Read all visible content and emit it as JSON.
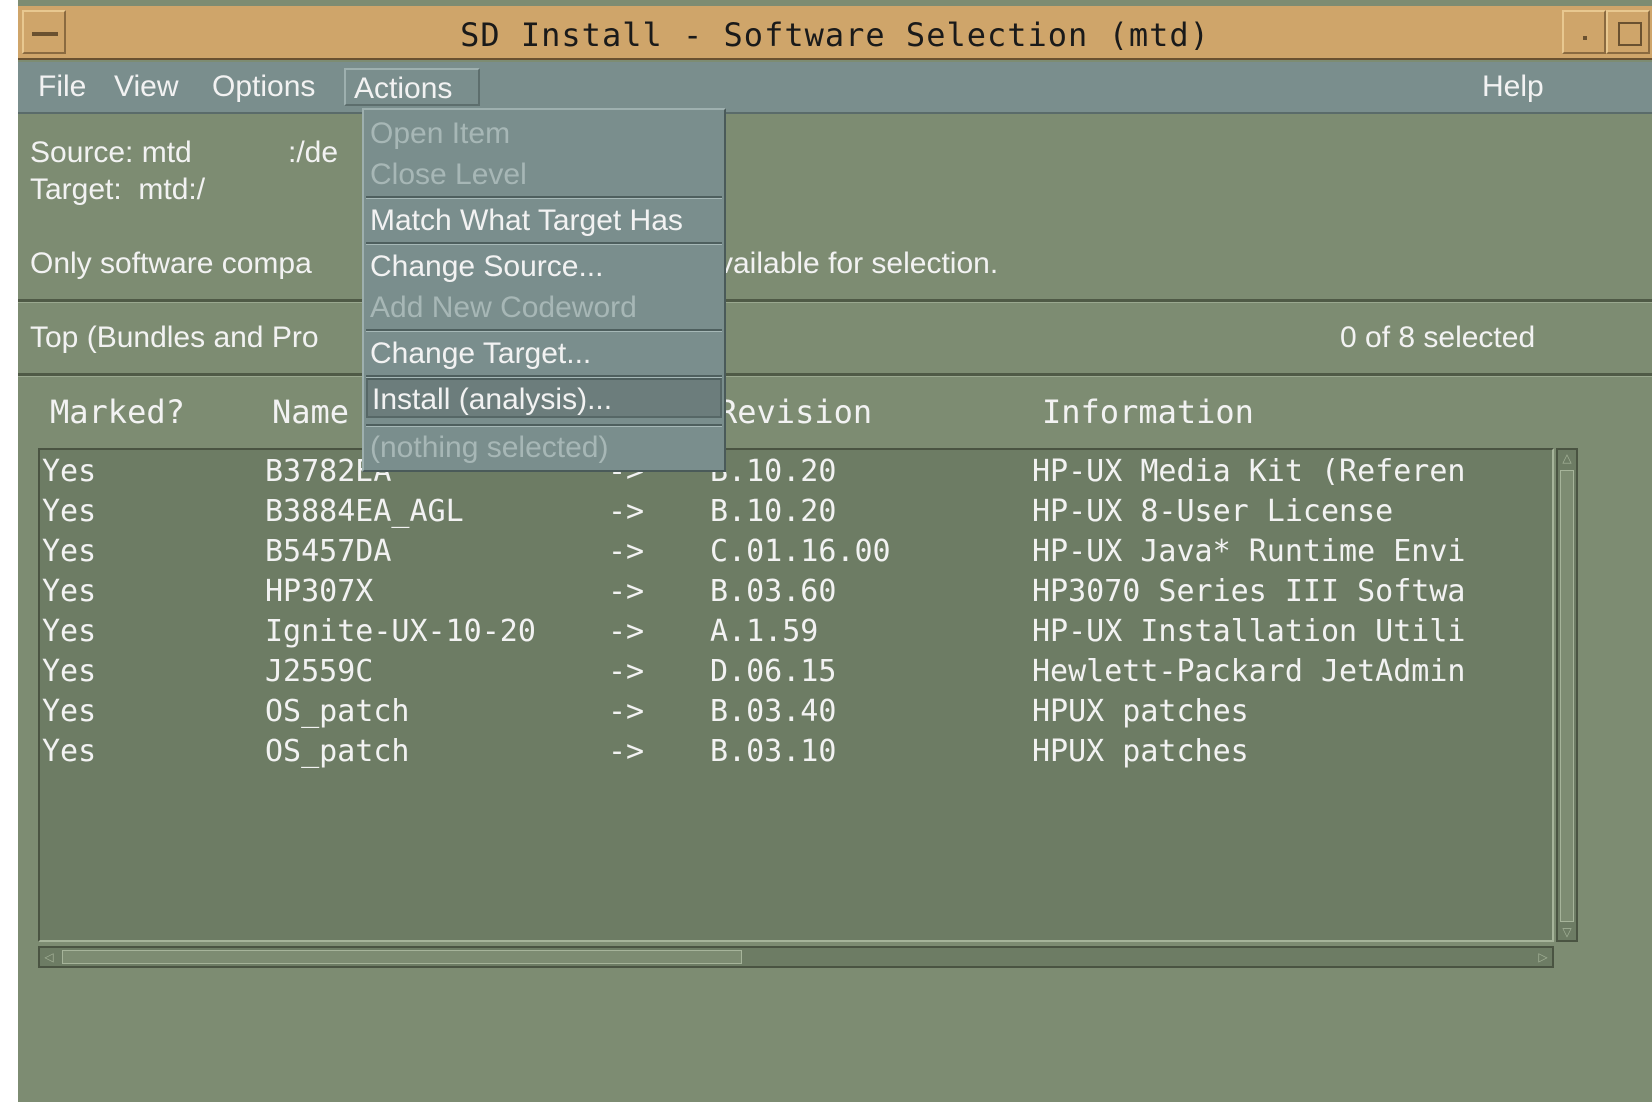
{
  "window": {
    "title": "SD Install - Software Selection (mtd)"
  },
  "menubar": {
    "file": "File",
    "view": "View",
    "options": "Options",
    "actions": "Actions",
    "help": "Help"
  },
  "info": {
    "source_label": "Source: mtd",
    "source_path": ":/de",
    "target": "Target:  mtd:/",
    "note_left": "Only software compa",
    "note_right": "vailable for selection.",
    "level_left": "Top (Bundles and Pro",
    "selected_count": "0 of 8 selected"
  },
  "columns": {
    "marked": "Marked?",
    "name": "Name",
    "revision": "Revision",
    "information": "Information"
  },
  "rows": [
    {
      "marked": "Yes",
      "name": "B3782EA",
      "arrow": "->",
      "revision": "B.10.20",
      "info": "HP-UX Media Kit (Referen"
    },
    {
      "marked": "Yes",
      "name": "B3884EA_AGL",
      "arrow": "->",
      "revision": "B.10.20",
      "info": "HP-UX 8-User License"
    },
    {
      "marked": "Yes",
      "name": "B5457DA",
      "arrow": "->",
      "revision": "C.01.16.00",
      "info": "HP-UX Java* Runtime Envi"
    },
    {
      "marked": "Yes",
      "name": "HP307X",
      "arrow": "->",
      "revision": "B.03.60",
      "info": "HP3070 Series III Softwa"
    },
    {
      "marked": "Yes",
      "name": "Ignite-UX-10-20",
      "arrow": "->",
      "revision": "A.1.59",
      "info": "HP-UX Installation Utili"
    },
    {
      "marked": "Yes",
      "name": "J2559C",
      "arrow": "->",
      "revision": "D.06.15",
      "info": "Hewlett-Packard JetAdmin"
    },
    {
      "marked": "Yes",
      "name": "OS_patch",
      "arrow": "->",
      "revision": "B.03.40",
      "info": "HPUX patches"
    },
    {
      "marked": "Yes",
      "name": "OS_patch",
      "arrow": "->",
      "revision": "B.03.10",
      "info": "HPUX patches"
    }
  ],
  "actions_menu": {
    "open_item": "Open Item",
    "close_level": "Close Level",
    "match_target": "Match What Target Has",
    "change_source": "Change Source...",
    "add_codeword": "Add New Codeword",
    "change_target": "Change Target...",
    "install_analysis": "Install (analysis)...",
    "nothing_selected": "(nothing selected)"
  },
  "colors": {
    "title_bar": "#cfa56a",
    "menu_bar": "#7a8e8d",
    "window_bg": "#7d8c72",
    "list_bg": "#6d7c64"
  }
}
